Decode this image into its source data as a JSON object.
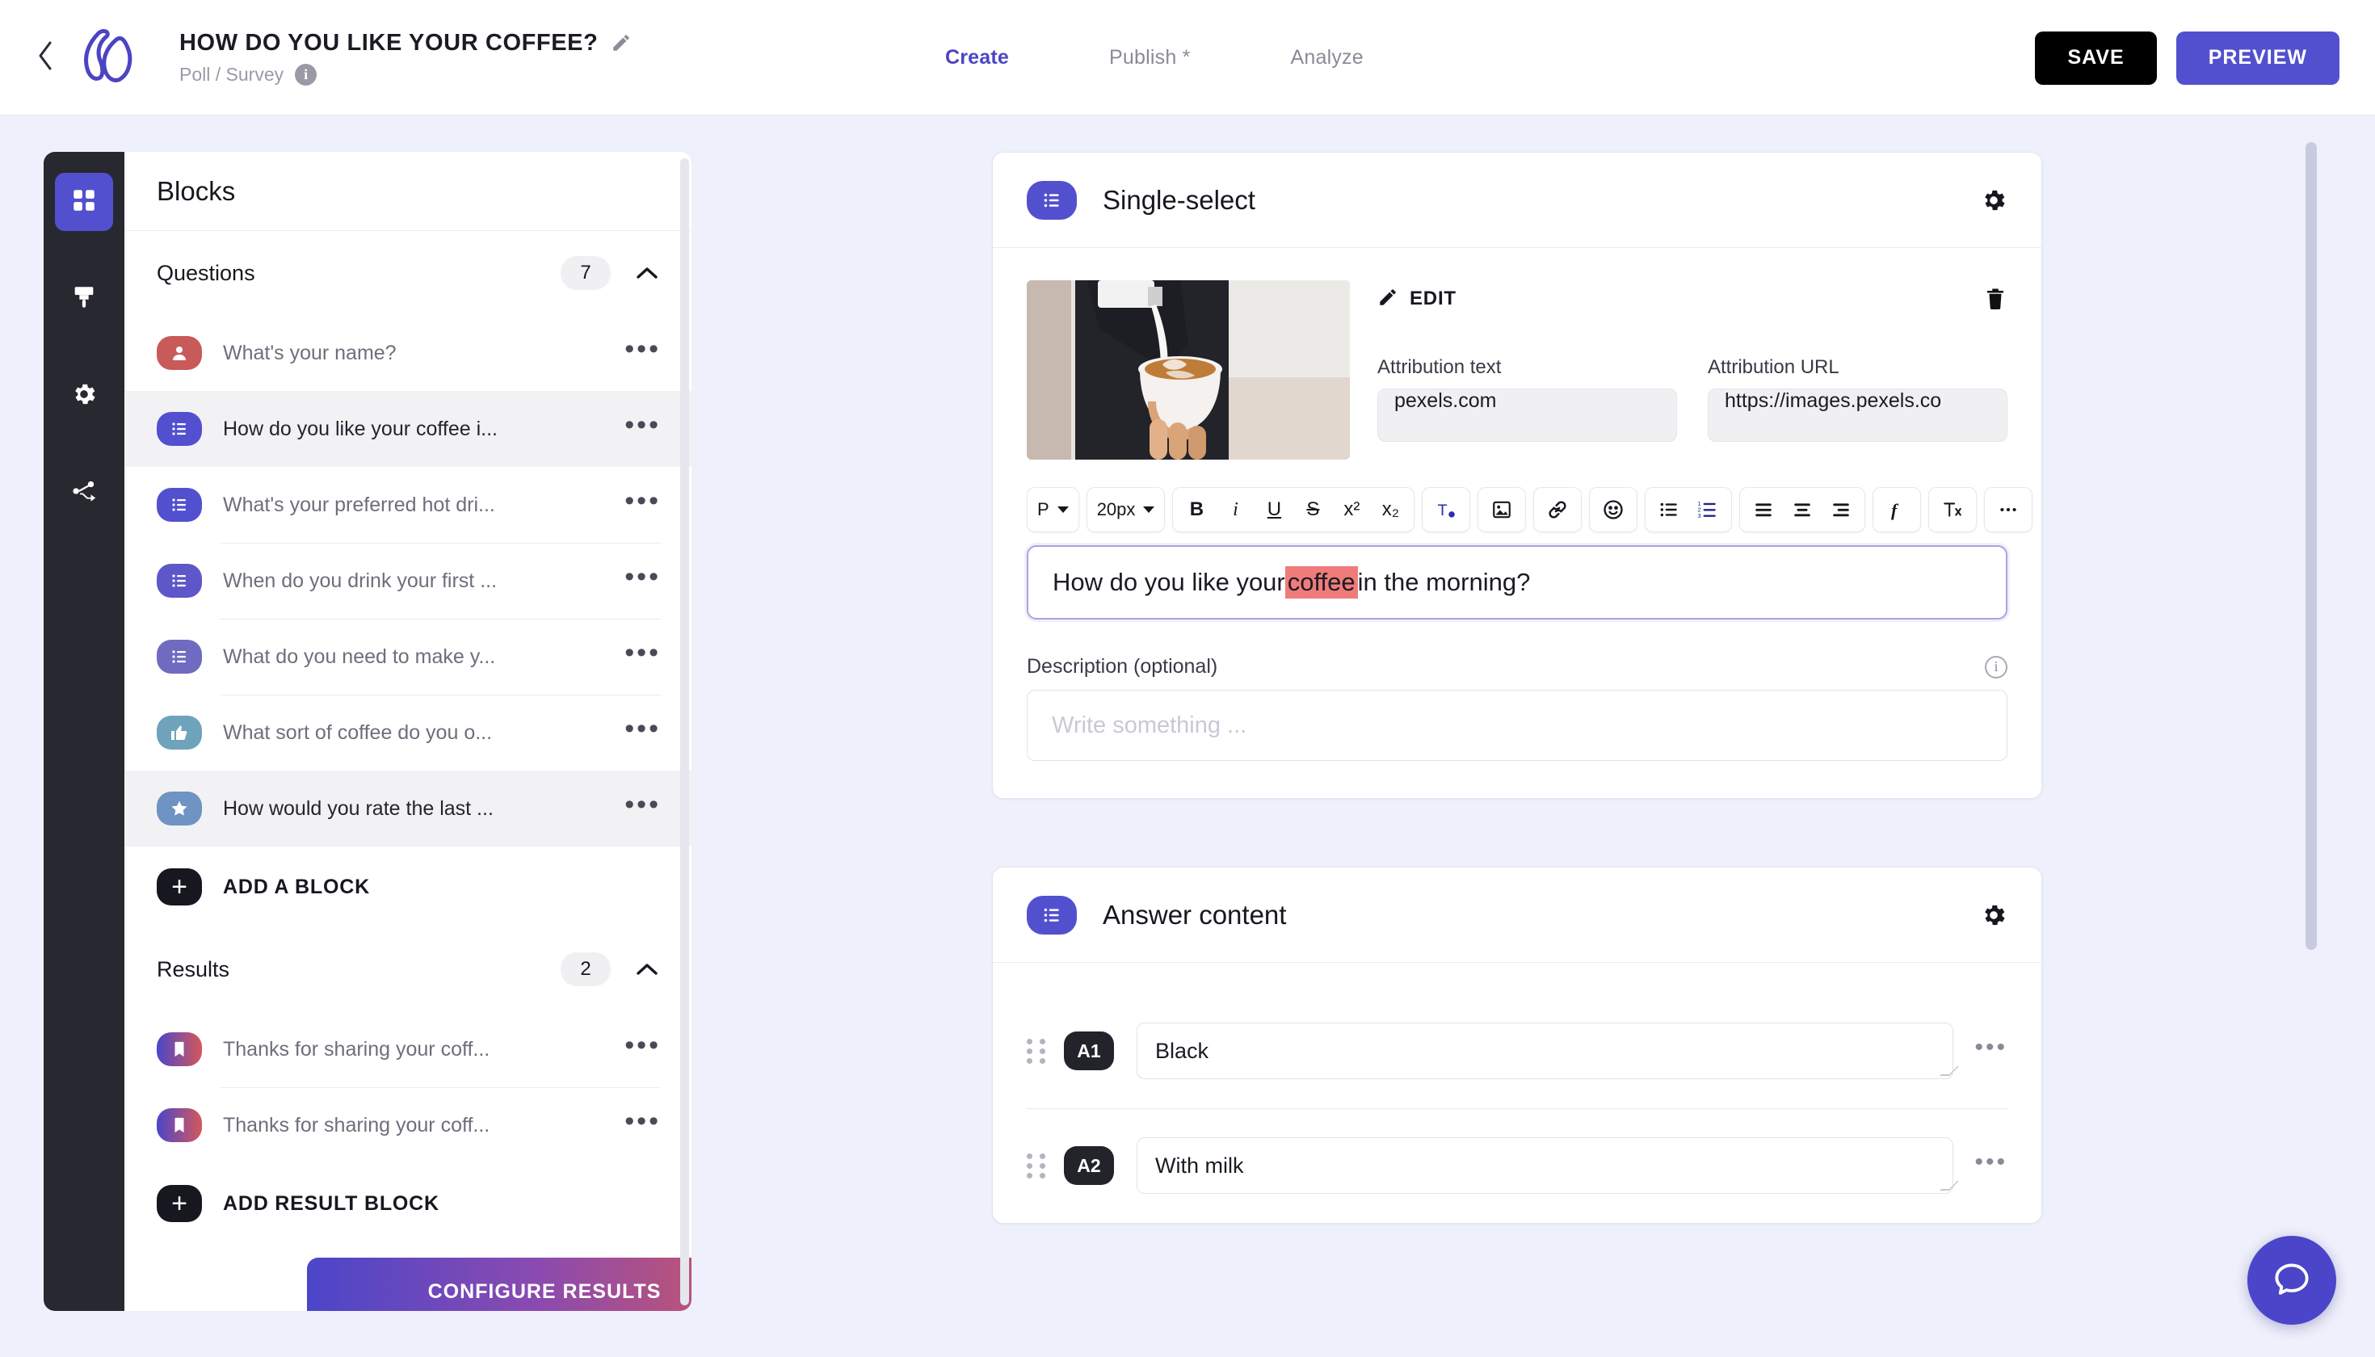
{
  "header": {
    "back_icon": "chevron-left-icon",
    "logo_icon": "brand-logo-icon",
    "title": "HOW DO YOU LIKE YOUR COFFEE?",
    "edit_icon": "pencil-icon",
    "subtitle": "Poll / Survey",
    "info_icon": "info-icon",
    "info_glyph": "i",
    "tabs": [
      {
        "label": "Create",
        "active": true
      },
      {
        "label": "Publish *",
        "active": false
      },
      {
        "label": "Analyze",
        "active": false
      }
    ],
    "save_label": "SAVE",
    "preview_label": "PREVIEW",
    "accent_color": "#5350cf"
  },
  "rail": {
    "items": [
      {
        "icon": "blocks-grid-icon",
        "active": true
      },
      {
        "icon": "paint-brush-icon",
        "active": false
      },
      {
        "icon": "gear-icon",
        "active": false
      },
      {
        "icon": "share-nodes-icon",
        "active": false
      }
    ]
  },
  "blocks_panel": {
    "title": "Blocks",
    "questions_section": {
      "title": "Questions",
      "count": "7",
      "collapse_icon": "chevron-up-icon",
      "items": [
        {
          "label": "What's your name?",
          "icon": "person-icon",
          "color": "#c95a5a",
          "selected": false
        },
        {
          "label": "How do you like your coffee i...",
          "icon": "list-icon",
          "color": "#5350cf",
          "selected": true
        },
        {
          "label": "What's your preferred hot dri...",
          "icon": "list-icon",
          "color": "#5350cf",
          "selected": false
        },
        {
          "label": "When do you drink your first ...",
          "icon": "list-icon",
          "color": "#5d57c9",
          "selected": false
        },
        {
          "label": "What do you need to make y...",
          "icon": "list-icon",
          "color": "#6f6bc0",
          "selected": false
        },
        {
          "label": "What sort of coffee do you o...",
          "icon": "thumbs-up-icon",
          "color": "#6fa3bc",
          "selected": false
        },
        {
          "label": "How would you rate the last ...",
          "icon": "star-icon",
          "color": "#6f93c2",
          "selected": true
        }
      ],
      "add_label": "ADD A BLOCK"
    },
    "results_section": {
      "title": "Results",
      "count": "2",
      "collapse_icon": "chevron-up-icon",
      "items": [
        {
          "label": "Thanks for sharing your coff...",
          "icon": "bookmark-icon",
          "selected": false
        },
        {
          "label": "Thanks for sharing your coff...",
          "icon": "bookmark-icon",
          "selected": false
        }
      ],
      "add_label": "ADD RESULT BLOCK"
    },
    "configure_label": "CONFIGURE RESULTS"
  },
  "question_card": {
    "type_label": "Single-select",
    "type_icon": "list-icon",
    "gear_icon": "gear-icon",
    "media": {
      "edit_label": "EDIT",
      "edit_icon": "pencil-icon",
      "delete_icon": "trash-icon",
      "attribution_text_label": "Attribution text",
      "attribution_text_value": "pexels.com",
      "attribution_url_label": "Attribution URL",
      "attribution_url_value": "https://images.pexels.co"
    },
    "toolbar": {
      "paragraph_value": "P",
      "fontsize_value": "20px",
      "bold": "B",
      "italic": "i",
      "underline": "U",
      "strikethrough": "S",
      "superscript": "x²",
      "subscript": "x₂",
      "text_color_icon": "text-color-icon",
      "image_icon": "image-icon",
      "link_icon": "link-icon",
      "emoji_icon": "emoji-icon",
      "bullet_list_icon": "bullet-list-icon",
      "numbered_list_icon": "numbered-list-icon",
      "align_left_icon": "align-left-icon",
      "align_center_icon": "align-center-icon",
      "align_right_icon": "align-right-icon",
      "formula_icon": "formula-icon",
      "clear_format_icon": "clear-format-icon",
      "more_icon": "more-horizontal-icon"
    },
    "question_text_before": "How do you like your ",
    "question_text_highlight": "coffee",
    "question_text_after": " in the morning?",
    "highlight_color": "#ef7b7b",
    "description_label": "Description (optional)",
    "description_info_icon": "info-icon",
    "description_placeholder": "Write something ..."
  },
  "answer_card": {
    "title": "Answer content",
    "type_icon": "list-icon",
    "gear_icon": "gear-icon",
    "rows": [
      {
        "tag": "A1",
        "value": "Black",
        "drag_icon": "drag-handle-icon",
        "more_icon": "more-horizontal-icon"
      },
      {
        "tag": "A2",
        "value": "With milk",
        "drag_icon": "drag-handle-icon",
        "more_icon": "more-horizontal-icon"
      }
    ]
  },
  "chat": {
    "icon": "chat-bubble-icon"
  }
}
